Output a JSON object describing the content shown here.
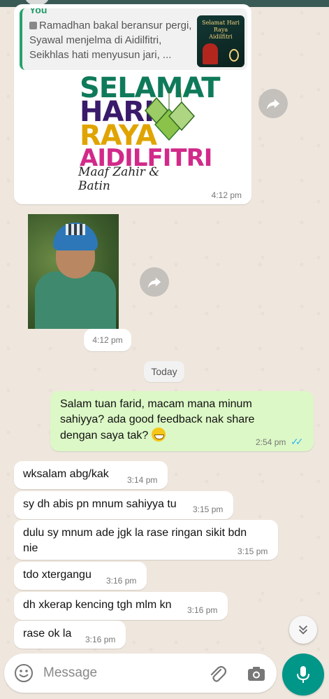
{
  "colors": {
    "chat_bg": "#ece5dd",
    "outgoing_bubble": "#dcf8c6",
    "incoming_bubble": "#ffffff",
    "accent": "#009688",
    "read_ticks": "#34b7f1"
  },
  "forwarded_card": {
    "sender": "You",
    "quote_text": "Ramadhan bakal beransur pergi, Syawal menjelma di Aidilfitri, Seikhlas hati menyusun jari, ...",
    "quote_thumb_text": "Selamat Hari Raya Aidilfitri",
    "poster_lines": [
      "SELAMAT",
      "HARI",
      "RAYA",
      "AIDILFITRI"
    ],
    "poster_subtitle": "Maaf Zahir & Batin",
    "time": "4:12 pm"
  },
  "photo_message": {
    "time": "4:12 pm"
  },
  "date_divider": "Today",
  "outgoing_message": {
    "text": "Salam tuan farid, macam mana minum sahiyya? ada good feedback nak share dengan saya tak?",
    "time": "2:54 pm"
  },
  "incoming_messages": [
    {
      "text": "wksalam abg/kak",
      "time": "3:14 pm"
    },
    {
      "text": "sy dh abis pn mnum sahiyya tu",
      "time": "3:15 pm"
    },
    {
      "text": "dulu sy mnum ade jgk la rase ringan sikit bdn nie",
      "time": "3:15 pm"
    },
    {
      "text": "tdo xtergangu",
      "time": "3:16 pm"
    },
    {
      "text": "dh xkerap kencing tgh mlm kn",
      "time": "3:16 pm"
    },
    {
      "text": "rase ok la",
      "time": "3:16 pm"
    }
  ],
  "composer": {
    "placeholder": "Message",
    "icons": [
      "emoji-icon",
      "attach-icon",
      "camera-icon",
      "mic-icon"
    ]
  }
}
